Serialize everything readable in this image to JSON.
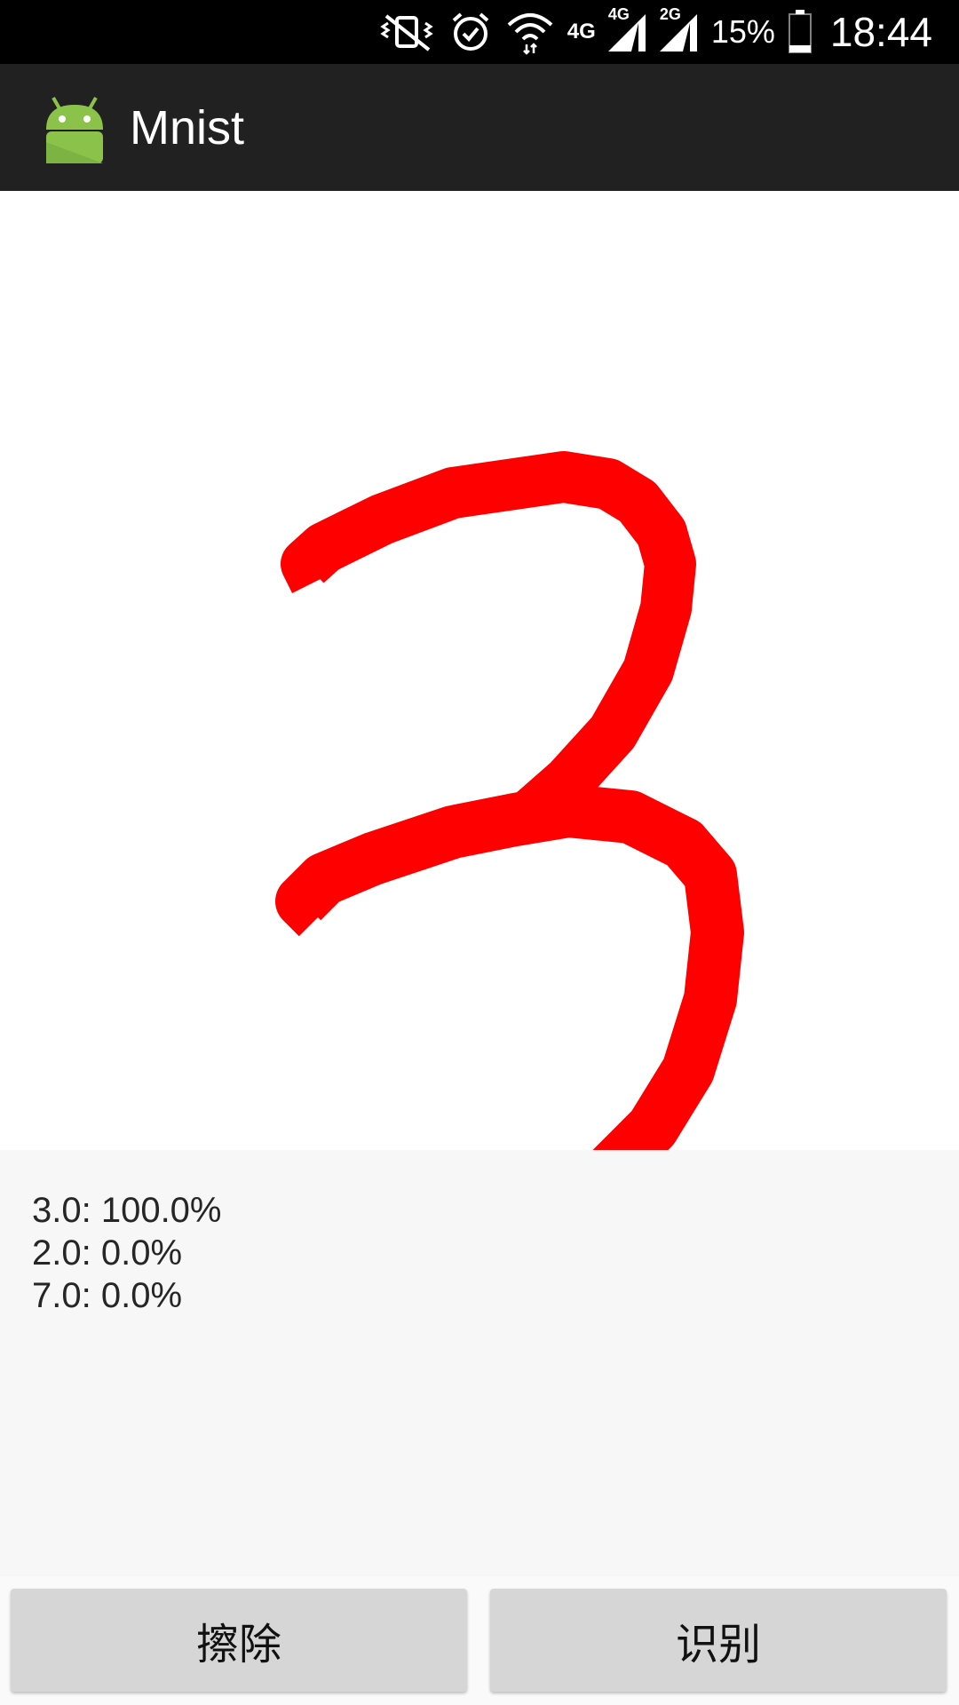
{
  "status_bar": {
    "network_type": "4G",
    "sim1_label": "4G",
    "sim2_label": "2G",
    "battery_percent": "15%",
    "clock": "18:44",
    "icons": [
      "vibrate-mute-icon",
      "alarm-icon",
      "wifi-icon",
      "signal-icon",
      "battery-icon"
    ]
  },
  "app_bar": {
    "title": "Mnist",
    "logo_icon": "android-logo-icon"
  },
  "canvas": {
    "stroke_color": "#ff0000",
    "drawn_digit": "3"
  },
  "results": {
    "lines": [
      "3.0: 100.0%",
      "2.0: 0.0%",
      "7.0: 0.0%"
    ]
  },
  "buttons": {
    "erase_label": "擦除",
    "recognize_label": "识别"
  },
  "colors": {
    "status_bar_bg": "#000000",
    "app_bar_bg": "#212121",
    "android_green": "#8bc34a",
    "button_bg": "#d6d6d6"
  }
}
